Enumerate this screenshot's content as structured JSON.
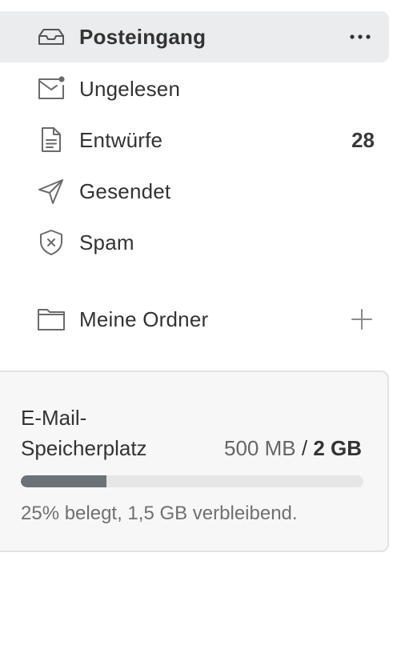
{
  "nav": {
    "items": [
      {
        "label": "Posteingang",
        "icon": "inbox-icon",
        "active": true
      },
      {
        "label": "Ungelesen",
        "icon": "envelope-unread-icon"
      },
      {
        "label": "Entwürfe",
        "icon": "document-icon",
        "count": "28"
      },
      {
        "label": "Gesendet",
        "icon": "send-icon"
      },
      {
        "label": "Spam",
        "icon": "shield-x-icon"
      }
    ]
  },
  "folders": {
    "label": "Meine Ordner",
    "icon": "folder-icon",
    "add_icon": "plus-icon"
  },
  "storage": {
    "title": "E-Mail-Speicherplatz",
    "used": "500 MB",
    "separator": "/",
    "total": "2 GB",
    "percent_used": 25,
    "status": "25% belegt, 1,5 GB verbleibend."
  },
  "colors": {
    "active_bg": "#ebecee",
    "icon_stroke": "#6b6b6b",
    "progress_fill": "#6b7278",
    "progress_track": "#e6e6e6",
    "card_bg": "#f7f7f7"
  }
}
